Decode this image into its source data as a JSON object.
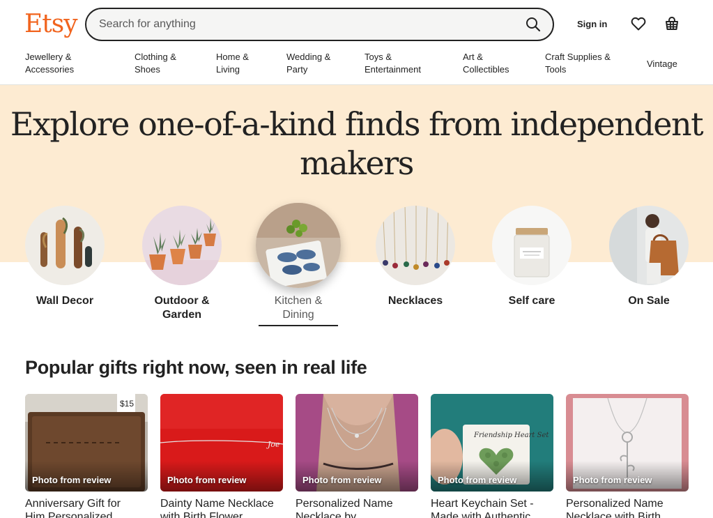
{
  "header": {
    "logo": "Etsy",
    "search_placeholder": "Search for anything",
    "signin_label": "Sign in",
    "favorites_icon": "heart-icon",
    "cart_icon": "basket-icon"
  },
  "nav": {
    "items": [
      {
        "label": "Jewellery &\nAccessories"
      },
      {
        "label": "Clothing &\nShoes"
      },
      {
        "label": "Home &\nLiving"
      },
      {
        "label": "Wedding &\nParty"
      },
      {
        "label": "Toys &\nEntertainment"
      },
      {
        "label": "Art &\nCollectibles"
      },
      {
        "label": "Craft Supplies &\nTools"
      },
      {
        "label": "Vintage"
      }
    ]
  },
  "hero": {
    "title": "Explore one-of-a-kind finds from independent makers",
    "categories": [
      {
        "label": "Wall Decor"
      },
      {
        "label": "Outdoor &\nGarden"
      },
      {
        "label": "Kitchen &\nDining",
        "active": true
      },
      {
        "label": "Necklaces"
      },
      {
        "label": "Self care"
      },
      {
        "label": "On Sale"
      }
    ]
  },
  "popular": {
    "title": "Popular gifts right now, seen in real life",
    "cards": [
      {
        "badge": "Photo from review",
        "title": "Anniversary Gift for\nHim Personalized"
      },
      {
        "badge": "Photo from review",
        "title": "Dainty Name Necklace\nwith Birth Flower"
      },
      {
        "badge": "Photo from review",
        "title": "Personalized Name\nNecklace by"
      },
      {
        "badge": "Photo from review",
        "title": "Heart Keychain Set -\nMade with Authentic"
      },
      {
        "badge": "Photo from review",
        "title": "Personalized Name\nNecklace with Birth"
      }
    ]
  },
  "colors": {
    "brand": "#f1641e",
    "hero_bg": "#fdebd2",
    "text": "#222222"
  }
}
